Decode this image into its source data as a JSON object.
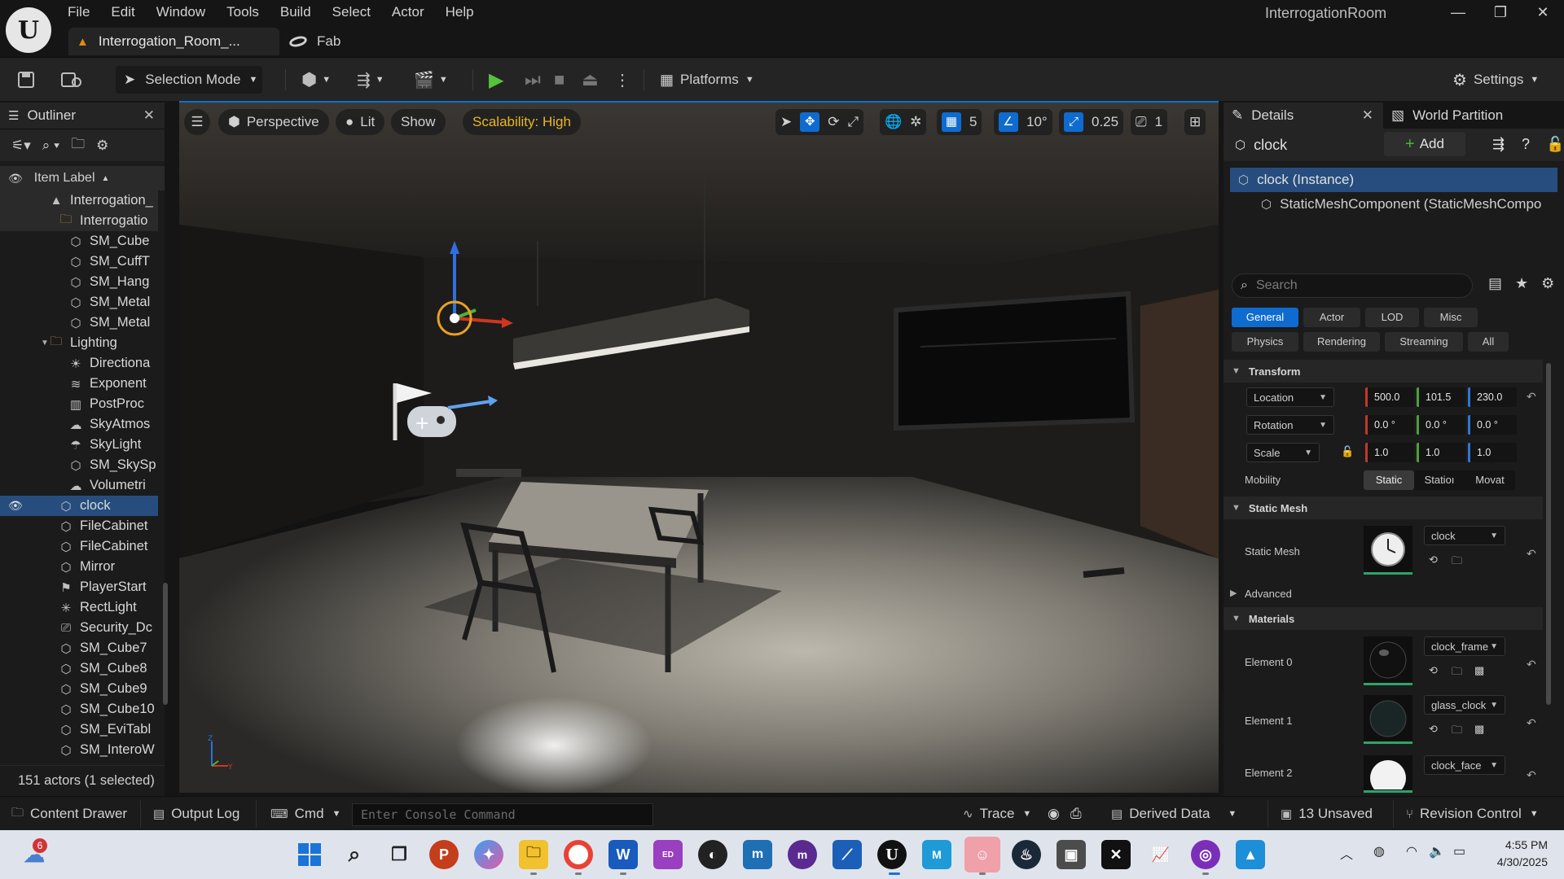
{
  "menu": [
    "File",
    "Edit",
    "Window",
    "Tools",
    "Build",
    "Select",
    "Actor",
    "Help"
  ],
  "window_title": "InterrogationRoom",
  "tabs": {
    "level": "Interrogation_Room_...",
    "fab": "Fab"
  },
  "toolbar": {
    "selection_mode": "Selection Mode",
    "platforms": "Platforms",
    "settings": "Settings"
  },
  "outliner": {
    "title": "Outliner",
    "column": "Item Label",
    "items": [
      {
        "label": "Interrogation_",
        "icon": "level-icon"
      },
      {
        "label": "Interrogatio",
        "icon": "folder-icon"
      },
      {
        "label": "SM_Cube",
        "icon": "mesh-icon"
      },
      {
        "label": "SM_CuffT",
        "icon": "mesh-icon"
      },
      {
        "label": "SM_Hang",
        "icon": "mesh-icon"
      },
      {
        "label": "SM_Metal",
        "icon": "mesh-icon"
      },
      {
        "label": "SM_Metal",
        "icon": "mesh-icon"
      },
      {
        "label": "Lighting",
        "icon": "folder-icon"
      },
      {
        "label": "Directiona",
        "icon": "sun-icon"
      },
      {
        "label": "Exponent",
        "icon": "fog-icon"
      },
      {
        "label": "PostProc",
        "icon": "postprocess-icon"
      },
      {
        "label": "SkyAtmos",
        "icon": "sky-icon"
      },
      {
        "label": "SkyLight",
        "icon": "skylight-icon"
      },
      {
        "label": "SM_SkySp",
        "icon": "mesh-icon"
      },
      {
        "label": "Volumetri",
        "icon": "cloud-icon"
      },
      {
        "label": "clock",
        "icon": "mesh-icon"
      },
      {
        "label": "FileCabinet",
        "icon": "mesh-icon"
      },
      {
        "label": "FileCabinet",
        "icon": "mesh-icon"
      },
      {
        "label": "Mirror",
        "icon": "mesh-icon"
      },
      {
        "label": "PlayerStart",
        "icon": "playerstart-icon"
      },
      {
        "label": "RectLight",
        "icon": "rectlight-icon"
      },
      {
        "label": "Security_Dc",
        "icon": "camera-icon"
      },
      {
        "label": "SM_Cube7",
        "icon": "mesh-icon"
      },
      {
        "label": "SM_Cube8",
        "icon": "mesh-icon"
      },
      {
        "label": "SM_Cube9",
        "icon": "mesh-icon"
      },
      {
        "label": "SM_Cube10",
        "icon": "mesh-icon"
      },
      {
        "label": "SM_EviTabl",
        "icon": "mesh-icon"
      },
      {
        "label": "SM_InteroW",
        "icon": "mesh-icon"
      }
    ],
    "footer": "151 actors (1 selected)"
  },
  "viewport": {
    "perspective": "Perspective",
    "lit": "Lit",
    "show": "Show",
    "scalability": "Scalability: High",
    "grid": "5",
    "angle": "10°",
    "scale_snap": "0.25",
    "camera_speed": "1"
  },
  "details": {
    "tab": "Details",
    "tab2": "World Partition",
    "actor": "clock",
    "add": "Add",
    "components": [
      "clock (Instance)",
      "StaticMeshComponent (StaticMeshCompo"
    ],
    "search_placeholder": "Search",
    "filters_row1": [
      "General",
      "Actor",
      "LOD",
      "Misc"
    ],
    "filters_row2": [
      "Physics",
      "Rendering",
      "Streaming",
      "All"
    ],
    "transform": {
      "title": "Transform",
      "location_label": "Location",
      "rotation_label": "Rotation",
      "scale_label": "Scale",
      "location": [
        "500.0",
        "101.5",
        "230.0"
      ],
      "rotation": [
        "0.0 °",
        "0.0 °",
        "0.0 °"
      ],
      "scale": [
        "1.0",
        "1.0",
        "1.0"
      ],
      "mobility_label": "Mobility",
      "mobility": [
        "Static",
        "Statioı",
        "Movat"
      ]
    },
    "static_mesh": {
      "title": "Static Mesh",
      "label": "Static Mesh",
      "value": "clock"
    },
    "advanced": "Advanced",
    "materials": {
      "title": "Materials",
      "items": [
        {
          "label": "Element 0",
          "value": "clock_frame"
        },
        {
          "label": "Element 1",
          "value": "glass_clock"
        },
        {
          "label": "Element 2",
          "value": "clock_face"
        }
      ]
    }
  },
  "statusbar": {
    "content_drawer": "Content Drawer",
    "output_log": "Output Log",
    "cmd": "Cmd",
    "console_placeholder": "Enter Console Command",
    "trace": "Trace",
    "derived_data": "Derived Data",
    "unsaved": "13 Unsaved",
    "revision_control": "Revision Control"
  },
  "taskbar": {
    "time": "4:55 PM",
    "date": "4/30/2025",
    "weather_badge": "6"
  }
}
